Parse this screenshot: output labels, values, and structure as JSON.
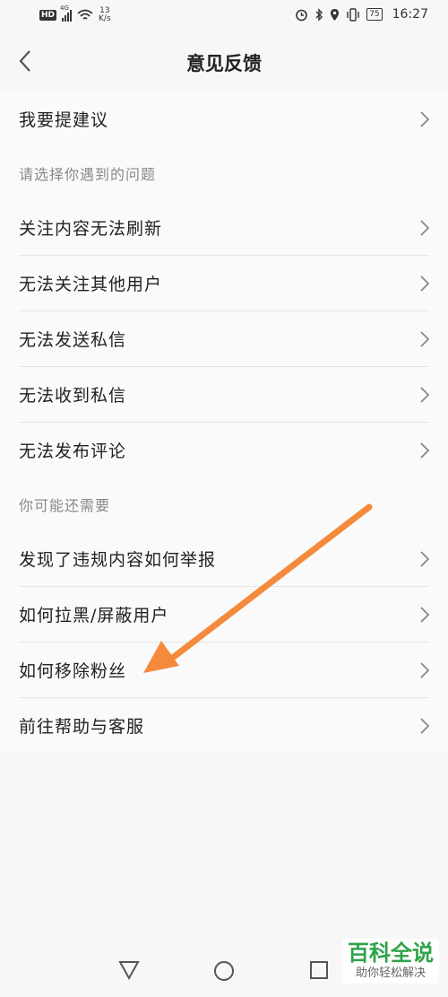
{
  "status_bar": {
    "signal_label": "4G",
    "net_speed_value": "13",
    "net_speed_unit": "K/s",
    "battery": "75",
    "time": "16:27"
  },
  "header": {
    "title": "意见反馈"
  },
  "top_item": {
    "label": "我要提建议"
  },
  "section_problems": {
    "title": "请选择你遇到的问题",
    "items": [
      "关注内容无法刷新",
      "无法关注其他用户",
      "无法发送私信",
      "无法收到私信",
      "无法发布评论"
    ]
  },
  "section_needs": {
    "title": "你可能还需要",
    "items": [
      "发现了违规内容如何举报",
      "如何拉黑/屏蔽用户",
      "如何移除粉丝",
      "前往帮助与客服"
    ]
  },
  "watermark": {
    "title": "百科全说",
    "subtitle": "助你轻松解决"
  },
  "colors": {
    "arrow": "#f58a3c",
    "watermark_green": "#2fa34a"
  }
}
